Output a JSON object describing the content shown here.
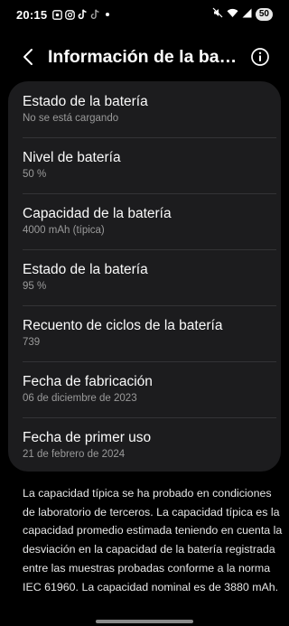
{
  "status_bar": {
    "time": "20:15",
    "battery_level": "50",
    "left_icons": [
      "gallery-icon",
      "instagram-icon",
      "tiktok-icon",
      "tiktok-icon",
      "notification-dot"
    ],
    "right_icons": [
      "mute-icon",
      "wifi-icon",
      "signal-icon"
    ]
  },
  "header": {
    "title": "Información de la batería",
    "back_icon": "chevron-left-icon",
    "info_icon": "info-icon"
  },
  "battery_info": [
    {
      "title": "Estado de la batería",
      "value": "No se está cargando"
    },
    {
      "title": "Nivel de batería",
      "value": "50 %"
    },
    {
      "title": "Capacidad de la batería",
      "value": "4000 mAh (típica)"
    },
    {
      "title": "Estado de la batería",
      "value": "95 %"
    },
    {
      "title": "Recuento de ciclos de la batería",
      "value": "739"
    },
    {
      "title": "Fecha de fabricación",
      "value": "06 de diciembre de 2023"
    },
    {
      "title": "Fecha de primer uso",
      "value": "21 de febrero de 2024"
    }
  ],
  "description": "La capacidad típica se ha probado en condiciones de laboratorio de terceros. La capacidad típica es la capacidad promedio estimada teniendo en cuenta la desviación en la capacidad de la batería registrada entre las muestras probadas conforme a la norma IEC 61960. La capacidad nominal es de 3880 mAh.",
  "colors": {
    "background": "#000000",
    "card": "#1c1c1e",
    "secondary_text": "#9a9a9a",
    "divider": "#333336"
  }
}
